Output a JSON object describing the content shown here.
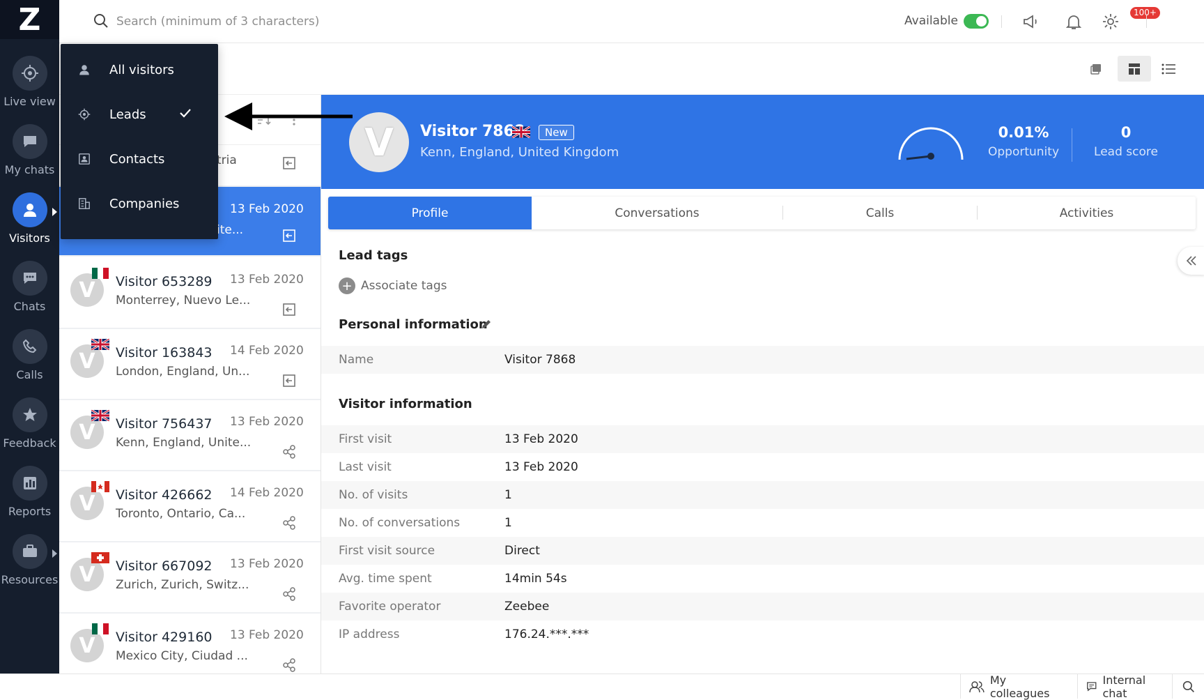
{
  "app": {
    "logo": "Z"
  },
  "sidebar": {
    "items": [
      {
        "label": "Live view",
        "icon": "crosshair-icon"
      },
      {
        "label": "My chats",
        "icon": "chat-bubble-icon"
      },
      {
        "label": "Visitors",
        "icon": "user-icon",
        "active": true
      },
      {
        "label": "Chats",
        "icon": "chat-dots-icon"
      },
      {
        "label": "Calls",
        "icon": "phone-icon"
      },
      {
        "label": "Feedback",
        "icon": "star-icon"
      },
      {
        "label": "Reports",
        "icon": "bar-chart-icon"
      },
      {
        "label": "Resources",
        "icon": "briefcase-icon"
      }
    ]
  },
  "topbar": {
    "search_placeholder": "Search (minimum of 3 characters)",
    "status_label": "Available",
    "notification_count": "100+"
  },
  "dropdown": {
    "items": [
      {
        "label": "All visitors",
        "icon": "user-icon"
      },
      {
        "label": "Leads",
        "icon": "crosshair-icon",
        "checked": true
      },
      {
        "label": "Contacts",
        "icon": "contact-card-icon"
      },
      {
        "label": "Companies",
        "icon": "building-icon"
      }
    ]
  },
  "visitor_list": {
    "partial_top_text": "tria",
    "selected_partial_loc": "ite...",
    "selected_date": "13 Feb 2020",
    "cards": [
      {
        "name": "Visitor 653289",
        "date": "13 Feb 2020",
        "location": "Monterrey, Nuevo Le...",
        "flag": "mexico",
        "action": "join-icon"
      },
      {
        "name": "Visitor 163843",
        "date": "14 Feb 2020",
        "location": "London, England, Un...",
        "flag": "uk",
        "action": "join-icon"
      },
      {
        "name": "Visitor 756437",
        "date": "13 Feb 2020",
        "location": "Kenn, England, Unite...",
        "flag": "uk",
        "action": "share-icon"
      },
      {
        "name": "Visitor 426662",
        "date": "14 Feb 2020",
        "location": "Toronto, Ontario, Ca...",
        "flag": "canada",
        "action": "share-icon"
      },
      {
        "name": "Visitor 667092",
        "date": "13 Feb 2020",
        "location": "Zurich, Zurich, Switz...",
        "flag": "switzerland",
        "action": "share-icon"
      },
      {
        "name": "Visitor 429160",
        "date": "13 Feb 2020",
        "location": "Mexico City, Ciudad ...",
        "flag": "mexico",
        "action": "share-icon"
      }
    ]
  },
  "visitor": {
    "avatar_letter": "V",
    "name": "Visitor 7868",
    "badge": "New",
    "location": "Kenn, England, United Kingdom",
    "opportunity_value": "0.01%",
    "opportunity_label": "Opportunity",
    "lead_score_value": "0",
    "lead_score_label": "Lead score"
  },
  "tabs": [
    "Profile",
    "Conversations",
    "Calls",
    "Activities"
  ],
  "profile": {
    "lead_tags_title": "Lead tags",
    "associate_tags": "Associate tags",
    "personal_title": "Personal information",
    "personal": [
      {
        "k": "Name",
        "v": "Visitor 7868"
      }
    ],
    "visitor_title": "Visitor information",
    "visitor_info": [
      {
        "k": "First visit",
        "v": "13 Feb 2020"
      },
      {
        "k": "Last visit",
        "v": "13 Feb 2020"
      },
      {
        "k": "No. of visits",
        "v": "1"
      },
      {
        "k": "No. of conversations",
        "v": "1"
      },
      {
        "k": "First visit source",
        "v": "Direct"
      },
      {
        "k": "Avg. time spent",
        "v": "14min 54s"
      },
      {
        "k": "Favorite operator",
        "v": "Zeebee"
      },
      {
        "k": "IP address",
        "v": "176.24.***.***"
      }
    ]
  },
  "footer": {
    "colleagues": "My colleagues",
    "internal_chat": "Internal chat"
  },
  "colors": {
    "sidebar_bg": "#151e2d",
    "accent": "#2f74e5",
    "status_green": "#3cb854",
    "badge_red": "#e53935"
  }
}
